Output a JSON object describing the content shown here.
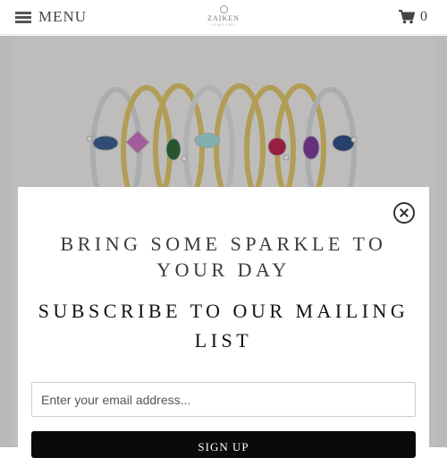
{
  "header": {
    "menu_label": "MENU",
    "logo_name": "ZAIKEN",
    "logo_sub": "JEWELRY",
    "cart_count": "0"
  },
  "icons": {
    "menu": "hamburger-icon",
    "cart": "shopping-cart-icon",
    "close": "close-icon"
  },
  "popup": {
    "tagline": "BRING SOME SPARKLE TO YOUR DAY",
    "heading": "SUBSCRIBE TO OUR MAILING LIST",
    "email_placeholder": "Enter your email address...",
    "email_value": "",
    "signup_label": "SIGN UP"
  },
  "colors": {
    "button_bg": "#0b0a09",
    "text_dark": "#3a3a3a",
    "hero_bg": "#eae7e5",
    "ring_gold": "#d9c06a",
    "ring_silver": "#cfd3d6"
  }
}
